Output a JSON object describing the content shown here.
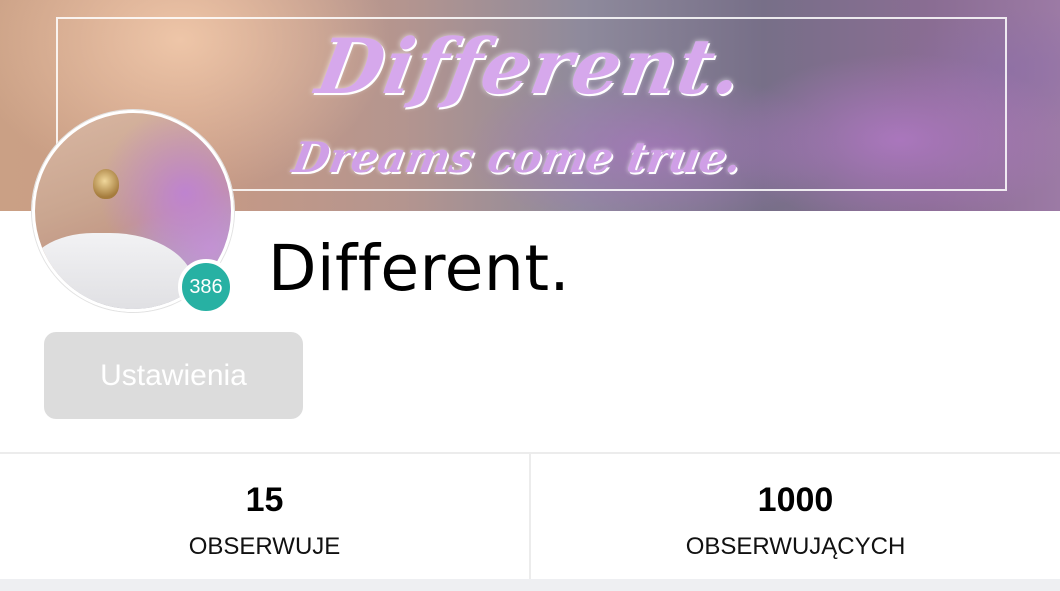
{
  "banner": {
    "title": "Different.",
    "tagline": "Dreams come true."
  },
  "profile": {
    "avatar_icon": "avatar-photo",
    "level": "386",
    "level_color": "#27b1a3",
    "username": "Different."
  },
  "actions": {
    "settings_label": "Ustawienia"
  },
  "stats": [
    {
      "value": "15",
      "label": "OBSERWUJE"
    },
    {
      "value": "1000",
      "label": "OBSERWUJĄCYCH"
    }
  ]
}
